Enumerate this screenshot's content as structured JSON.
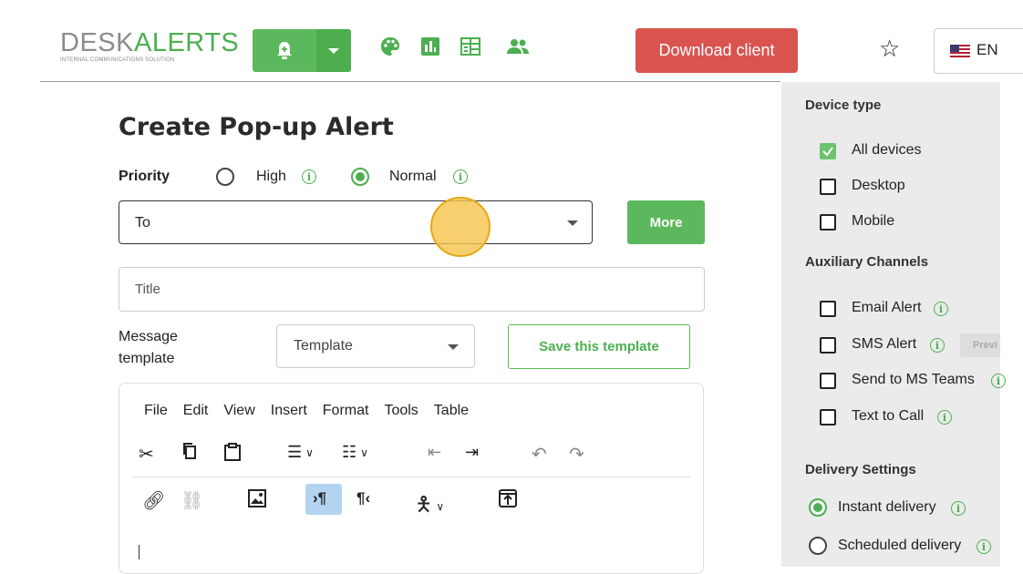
{
  "header": {
    "logo_desk": "DESK",
    "logo_alerts": "ALERTS",
    "logo_tagline": "INTERNAL COMMUNICATIONS SOLUTION",
    "icons": [
      "bell-plus-icon",
      "palette-icon",
      "chart-icon",
      "table-icon",
      "users-icon"
    ],
    "download_label": "Download client",
    "language": "EN",
    "accent_green": "#5cb85c",
    "download_red": "#d9534f"
  },
  "form": {
    "title": "Create Pop-up Alert",
    "priority_label": "Priority",
    "priority_options": [
      {
        "label": "High",
        "selected": false
      },
      {
        "label": "Normal",
        "selected": true
      }
    ],
    "to_placeholder": "To",
    "more_label": "More",
    "title_placeholder": "Title",
    "message_template_label_1": "Message",
    "message_template_label_2": "template",
    "template_select": "Template",
    "save_template_label": "Save this template"
  },
  "editor": {
    "menu": [
      "File",
      "Edit",
      "View",
      "Insert",
      "Format",
      "Tools",
      "Table"
    ]
  },
  "panel": {
    "device_type_heading": "Device type",
    "devices": [
      {
        "label": "All devices",
        "checked": true
      },
      {
        "label": "Desktop",
        "checked": false
      },
      {
        "label": "Mobile",
        "checked": false
      }
    ],
    "aux_heading": "Auxiliary Channels",
    "channels": [
      {
        "label": "Email Alert",
        "checked": false
      },
      {
        "label": "SMS Alert",
        "checked": false
      },
      {
        "label": "Send to MS Teams",
        "checked": false
      },
      {
        "label": "Text to Call",
        "checked": false
      }
    ],
    "preview_label": "Previ",
    "delivery_heading": "Delivery Settings",
    "delivery_options": [
      {
        "label": "Instant delivery",
        "selected": true
      },
      {
        "label": "Scheduled delivery",
        "selected": false
      }
    ]
  }
}
